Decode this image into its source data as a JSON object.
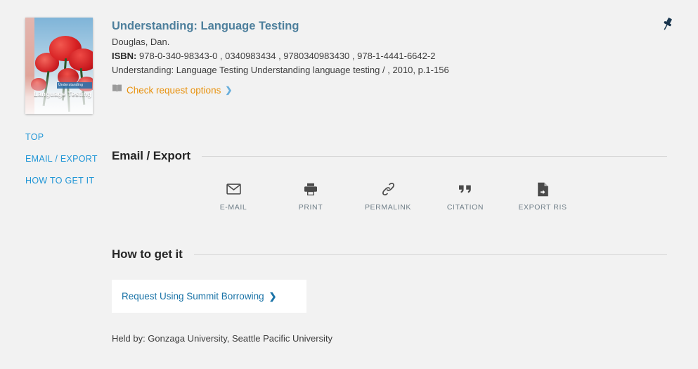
{
  "record": {
    "title": "Understanding: Language Testing",
    "author": "Douglas, Dan.",
    "isbn_label": "ISBN:",
    "isbn_values": "978-0-340-98343-0 , 0340983434 , 9780340983430 , 978-1-4441-6642-2",
    "details": "Understanding: Language Testing Understanding language testing / , 2010, p.1-156",
    "request_options_label": "Check request options",
    "request_options_icon": "open-book-icon",
    "request_options_chevron": "❯",
    "pin_icon": "pushpin-icon",
    "cover": {
      "band_text": "Understanding",
      "title_text": "Language Testing",
      "alt": "book-cover-red-poppies"
    }
  },
  "left_nav": {
    "items": [
      {
        "label": "TOP",
        "name": "nav-top"
      },
      {
        "label": "EMAIL / EXPORT",
        "name": "nav-email-export"
      },
      {
        "label": "HOW TO GET IT",
        "name": "nav-how-to-get-it"
      }
    ]
  },
  "email_export": {
    "heading": "Email / Export",
    "actions": [
      {
        "label": "E-MAIL",
        "icon": "envelope-icon"
      },
      {
        "label": "PRINT",
        "icon": "printer-icon"
      },
      {
        "label": "PERMALINK",
        "icon": "link-chain-icon"
      },
      {
        "label": "CITATION",
        "icon": "quotation-marks-icon"
      },
      {
        "label": "EXPORT RIS",
        "icon": "file-export-icon"
      }
    ]
  },
  "how_to_get_it": {
    "heading": "How to get it",
    "request_button_label": "Request Using Summit Borrowing",
    "request_button_chevron": "❯",
    "held_by": "Held by: Gonzaga University, Seattle Pacific University"
  },
  "colors": {
    "page_background": "#f2f2f2",
    "title_blue": "#4d7f9c",
    "nav_blue": "#2196d6",
    "link_orange": "#e8910c",
    "request_blue": "#1a73a7",
    "icon_gray": "#4a4a4a",
    "icon_label_gray": "#6e7d87",
    "rule_gray": "#d6d6d6"
  }
}
